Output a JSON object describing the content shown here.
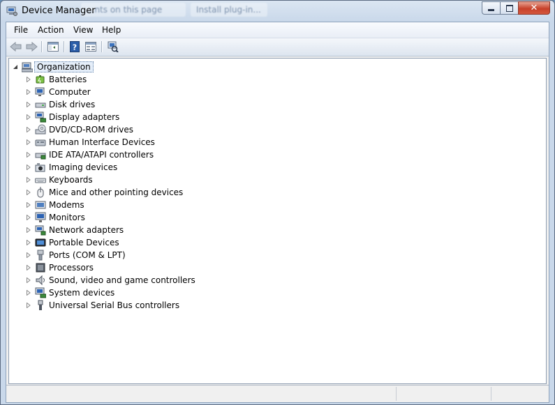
{
  "window": {
    "title": "Device Manager",
    "background_ghost_texts": [
      "...nts on this page",
      "Install plug-in..."
    ]
  },
  "caption_buttons": {
    "minimize": "—",
    "maximize": "□",
    "close": "✕"
  },
  "menu": [
    "File",
    "Action",
    "View",
    "Help"
  ],
  "toolbar": {
    "icons": [
      "back-arrow-icon",
      "forward-arrow-icon",
      "show-hide-console-tree-icon",
      "help-icon",
      "properties-icon",
      "scan-hardware-icon"
    ]
  },
  "tree": {
    "root": "Organization",
    "items": [
      {
        "label": "Batteries",
        "icon": "battery-icon"
      },
      {
        "label": "Computer",
        "icon": "computer-icon"
      },
      {
        "label": "Disk drives",
        "icon": "disk-drive-icon"
      },
      {
        "label": "Display adapters",
        "icon": "display-adapter-icon"
      },
      {
        "label": "DVD/CD-ROM drives",
        "icon": "dvd-drive-icon"
      },
      {
        "label": "Human Interface Devices",
        "icon": "hid-icon"
      },
      {
        "label": "IDE ATA/ATAPI controllers",
        "icon": "ide-controller-icon"
      },
      {
        "label": "Imaging devices",
        "icon": "camera-icon"
      },
      {
        "label": "Keyboards",
        "icon": "keyboard-icon"
      },
      {
        "label": "Mice and other pointing devices",
        "icon": "mouse-icon"
      },
      {
        "label": "Modems",
        "icon": "modem-icon"
      },
      {
        "label": "Monitors",
        "icon": "monitor-icon"
      },
      {
        "label": "Network adapters",
        "icon": "network-adapter-icon"
      },
      {
        "label": "Portable Devices",
        "icon": "portable-device-icon"
      },
      {
        "label": "Ports (COM & LPT)",
        "icon": "port-icon"
      },
      {
        "label": "Processors",
        "icon": "processor-icon"
      },
      {
        "label": "Sound, video and game controllers",
        "icon": "speaker-icon"
      },
      {
        "label": "System devices",
        "icon": "system-device-icon"
      },
      {
        "label": "Universal Serial Bus controllers",
        "icon": "usb-icon"
      }
    ]
  }
}
